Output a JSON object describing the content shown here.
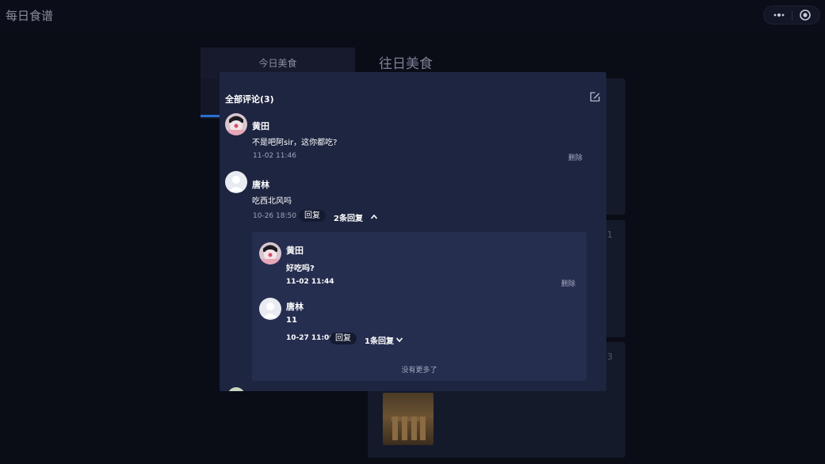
{
  "app": {
    "title": "每日食谱"
  },
  "background": {
    "tab_today": "今日美食",
    "past_title": "往日美食",
    "card_numbers": [
      "1",
      "3"
    ]
  },
  "modal": {
    "header": "全部评论(3)",
    "comments": [
      {
        "name": "黄田",
        "content": "不是吧阿sir，这你都吃?",
        "time": "11-02 11:46",
        "delete_label": "删除"
      },
      {
        "name": "唐林",
        "content": "吃西北风吗",
        "time": "10-26 18:50",
        "reply_label": "回复",
        "reply_count": "2条回复"
      }
    ],
    "replies": [
      {
        "name": "黄田",
        "content": "好吃吗?",
        "time": "11-02 11:44",
        "delete_label": "删除"
      },
      {
        "name": "唐林",
        "content": "11",
        "time": "10-27 11:06",
        "reply_label": "回复",
        "reply_count": "1条回复"
      }
    ],
    "no_more": "没有更多了"
  }
}
